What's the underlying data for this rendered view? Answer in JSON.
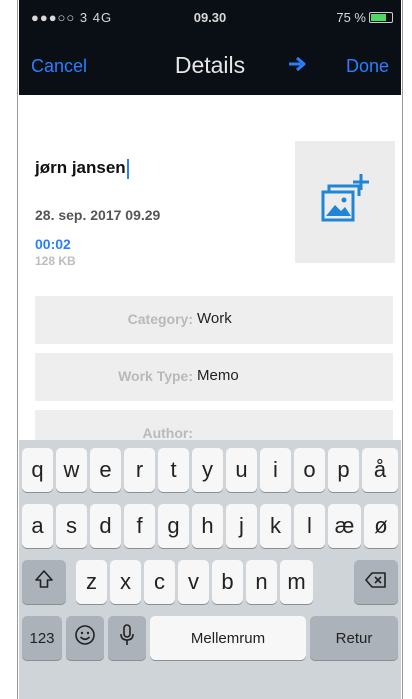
{
  "status_bar": {
    "carrier": "●●●○○ 3  4G",
    "time": "09.30",
    "battery": "75 %",
    "battery_level": 0.75
  },
  "nav": {
    "cancel": "Cancel",
    "title": "Details",
    "forward_icon": "arrow-right",
    "done": "Done"
  },
  "recording": {
    "name": "jørn jansen",
    "date": "28. sep. 2017 09.29",
    "duration": "00:02",
    "size": "128 KB",
    "photo_icon": "add-photo"
  },
  "fields": [
    {
      "label": "Category:",
      "value": "Work"
    },
    {
      "label": "Work Type:",
      "value": "Memo"
    },
    {
      "label": "Author:",
      "value": ""
    }
  ],
  "keyboard": {
    "row1": [
      "q",
      "w",
      "e",
      "r",
      "t",
      "y",
      "u",
      "i",
      "o",
      "p",
      "å"
    ],
    "row2": [
      "a",
      "s",
      "d",
      "f",
      "g",
      "h",
      "j",
      "k",
      "l",
      "æ",
      "ø"
    ],
    "row3": [
      "z",
      "x",
      "c",
      "v",
      "b",
      "n",
      "m"
    ],
    "numbers": "123",
    "space": "Mellemrum",
    "return": "Retur"
  },
  "colors": {
    "accent": "#2a7fff",
    "bar": "#0a0f16",
    "field": "#eeeeee",
    "keyboard": "#cfd4d9"
  }
}
